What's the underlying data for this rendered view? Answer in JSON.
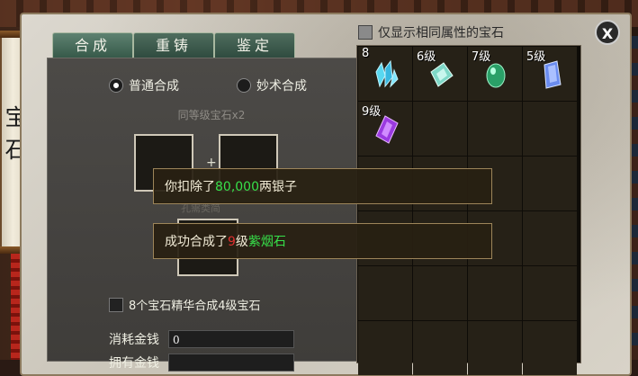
{
  "side_panel": {
    "title_chars": [
      "宝",
      "石"
    ]
  },
  "tabs": [
    {
      "label": "合成",
      "active": true
    },
    {
      "label": "重铸",
      "active": false
    },
    {
      "label": "鉴定",
      "active": false
    }
  ],
  "close_label": "X",
  "help_label": "?",
  "synthesis": {
    "mode_normal": "普通合成",
    "mode_special": "妙术合成",
    "selected_mode": "normal",
    "same_level_label": "同等级宝石x2",
    "plus": "+",
    "result_label": "孔需类简",
    "essence_checkbox_label": "8个宝石精华合成4级宝石",
    "cost_label": "消耗金钱",
    "cost_value": "0",
    "cost2_label": "拥有金钱"
  },
  "inventory": {
    "filter_label": "仅显示相同属性的宝石",
    "cells": [
      {
        "level": "8",
        "gem": "cyan-crystal"
      },
      {
        "level": "6级",
        "gem": "teal-prism"
      },
      {
        "level": "7级",
        "gem": "green-egg"
      },
      {
        "level": "5级",
        "gem": "blue-crystal"
      },
      {
        "level": "9级",
        "gem": "purple-crystal"
      }
    ],
    "total_cells": 24
  },
  "popups": {
    "money_prefix": "你扣除了",
    "money_amount": "80,000",
    "money_suffix": "两银子",
    "success_prefix": "成功合成了",
    "success_level": "9",
    "success_level_suffix": "级",
    "success_item": "紫烟石"
  },
  "colors": {
    "highlight_green": "#37e04a",
    "highlight_red": "#e03030",
    "tab_green": "#355848"
  }
}
